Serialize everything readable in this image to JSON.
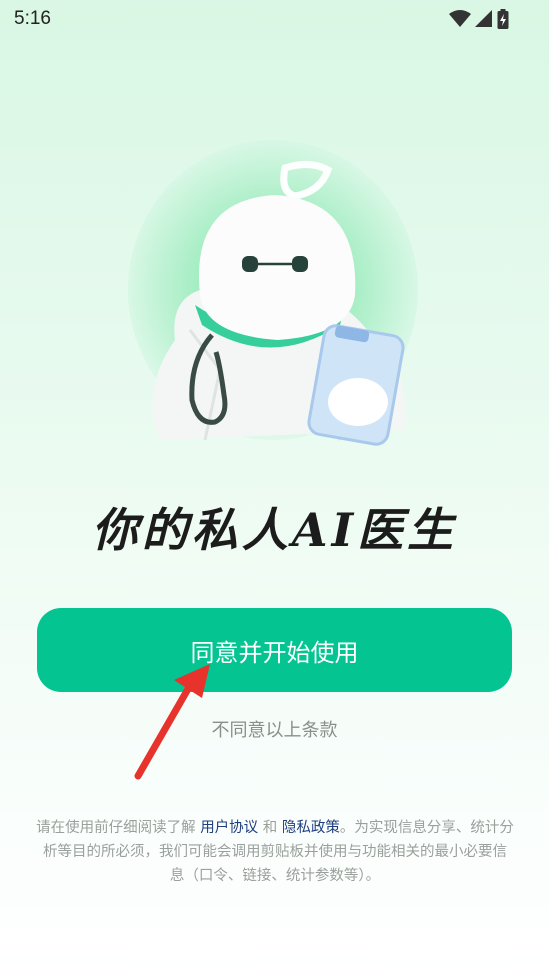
{
  "status_bar": {
    "time": "5:16",
    "icons": [
      "wifi-icon",
      "signal-icon",
      "battery-charging-icon"
    ]
  },
  "hero": {
    "image": "doctor-robot-mascot"
  },
  "headline": "你的私人AI医生",
  "cta": {
    "label": "同意并开始使用",
    "color": "#04c492"
  },
  "decline": {
    "label": "不同意以上条款"
  },
  "notice": {
    "prefix": "请在使用前仔细阅读了解",
    "user_agreement": "用户协议",
    "and": "和",
    "privacy_policy": "隐私政策",
    "suffix": "。为实现信息分享、统计分析等目的所必须，我们可能会调用剪贴板并使用与功能相关的最小必要信息（口令、链接、统计参数等）。"
  },
  "colors": {
    "accent": "#04c492",
    "link": "#1f3f80",
    "annotation_arrow": "#e8322c"
  }
}
